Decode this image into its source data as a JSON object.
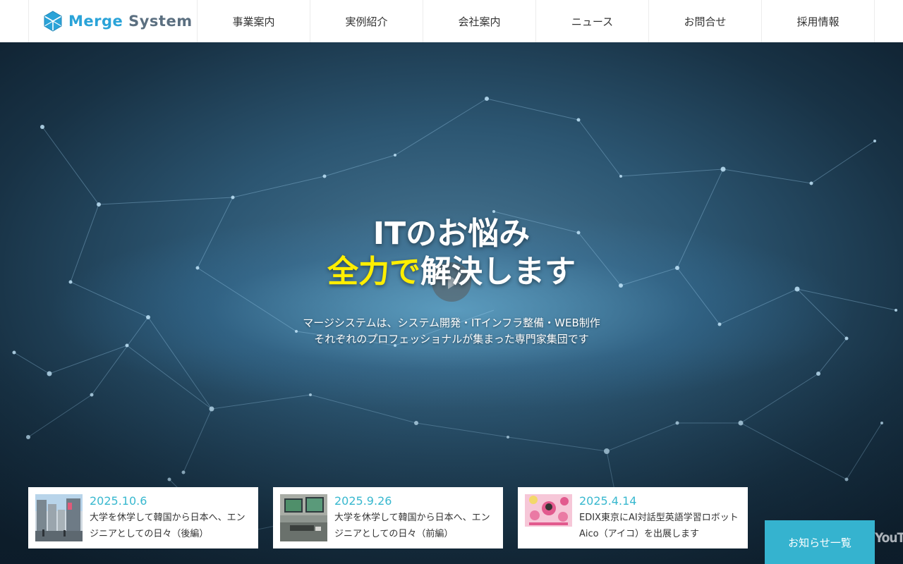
{
  "header": {
    "logo": {
      "word1": "Merge",
      "word2": "System",
      "icon": "merge-system-logo-icon"
    },
    "nav": [
      {
        "label": "事業案内"
      },
      {
        "label": "実例紹介"
      },
      {
        "label": "会社案内"
      },
      {
        "label": "ニュース"
      },
      {
        "label": "お問合せ"
      },
      {
        "label": "採用情報"
      }
    ]
  },
  "hero": {
    "line1": "ITのお悩み",
    "line2_highlight": "全力で",
    "line2_rest": "解決します",
    "sub1": "マージシステムは、システム開発・ITインフラ整備・WEB制作",
    "sub2": "それぞれのプロフェッショナルが集まった専門家集団です",
    "highlight_color": "#ffee00"
  },
  "news": [
    {
      "date": "2025.10.6",
      "title": "大学を休学して韓国から日本へ、エンジニアとしての日々（後編）",
      "thumb": "city-street-photo"
    },
    {
      "date": "2025.9.26",
      "title": "大学を休学して韓国から日本へ、エンジニアとしての日々（前編）",
      "thumb": "office-desk-photo"
    },
    {
      "date": "2025.4.14",
      "title": "EDIX東京にAI対話型英語学習ロボットAico（アイコ）を出展します",
      "thumb": "event-flyer-pink"
    }
  ],
  "news_all_label": "お知らせ一覧",
  "video_watermark": "YouTub",
  "colors": {
    "accent": "#35b3cf",
    "date": "#38b8cf",
    "logo_blue": "#2aa3d8",
    "logo_gray": "#5b6f80"
  }
}
